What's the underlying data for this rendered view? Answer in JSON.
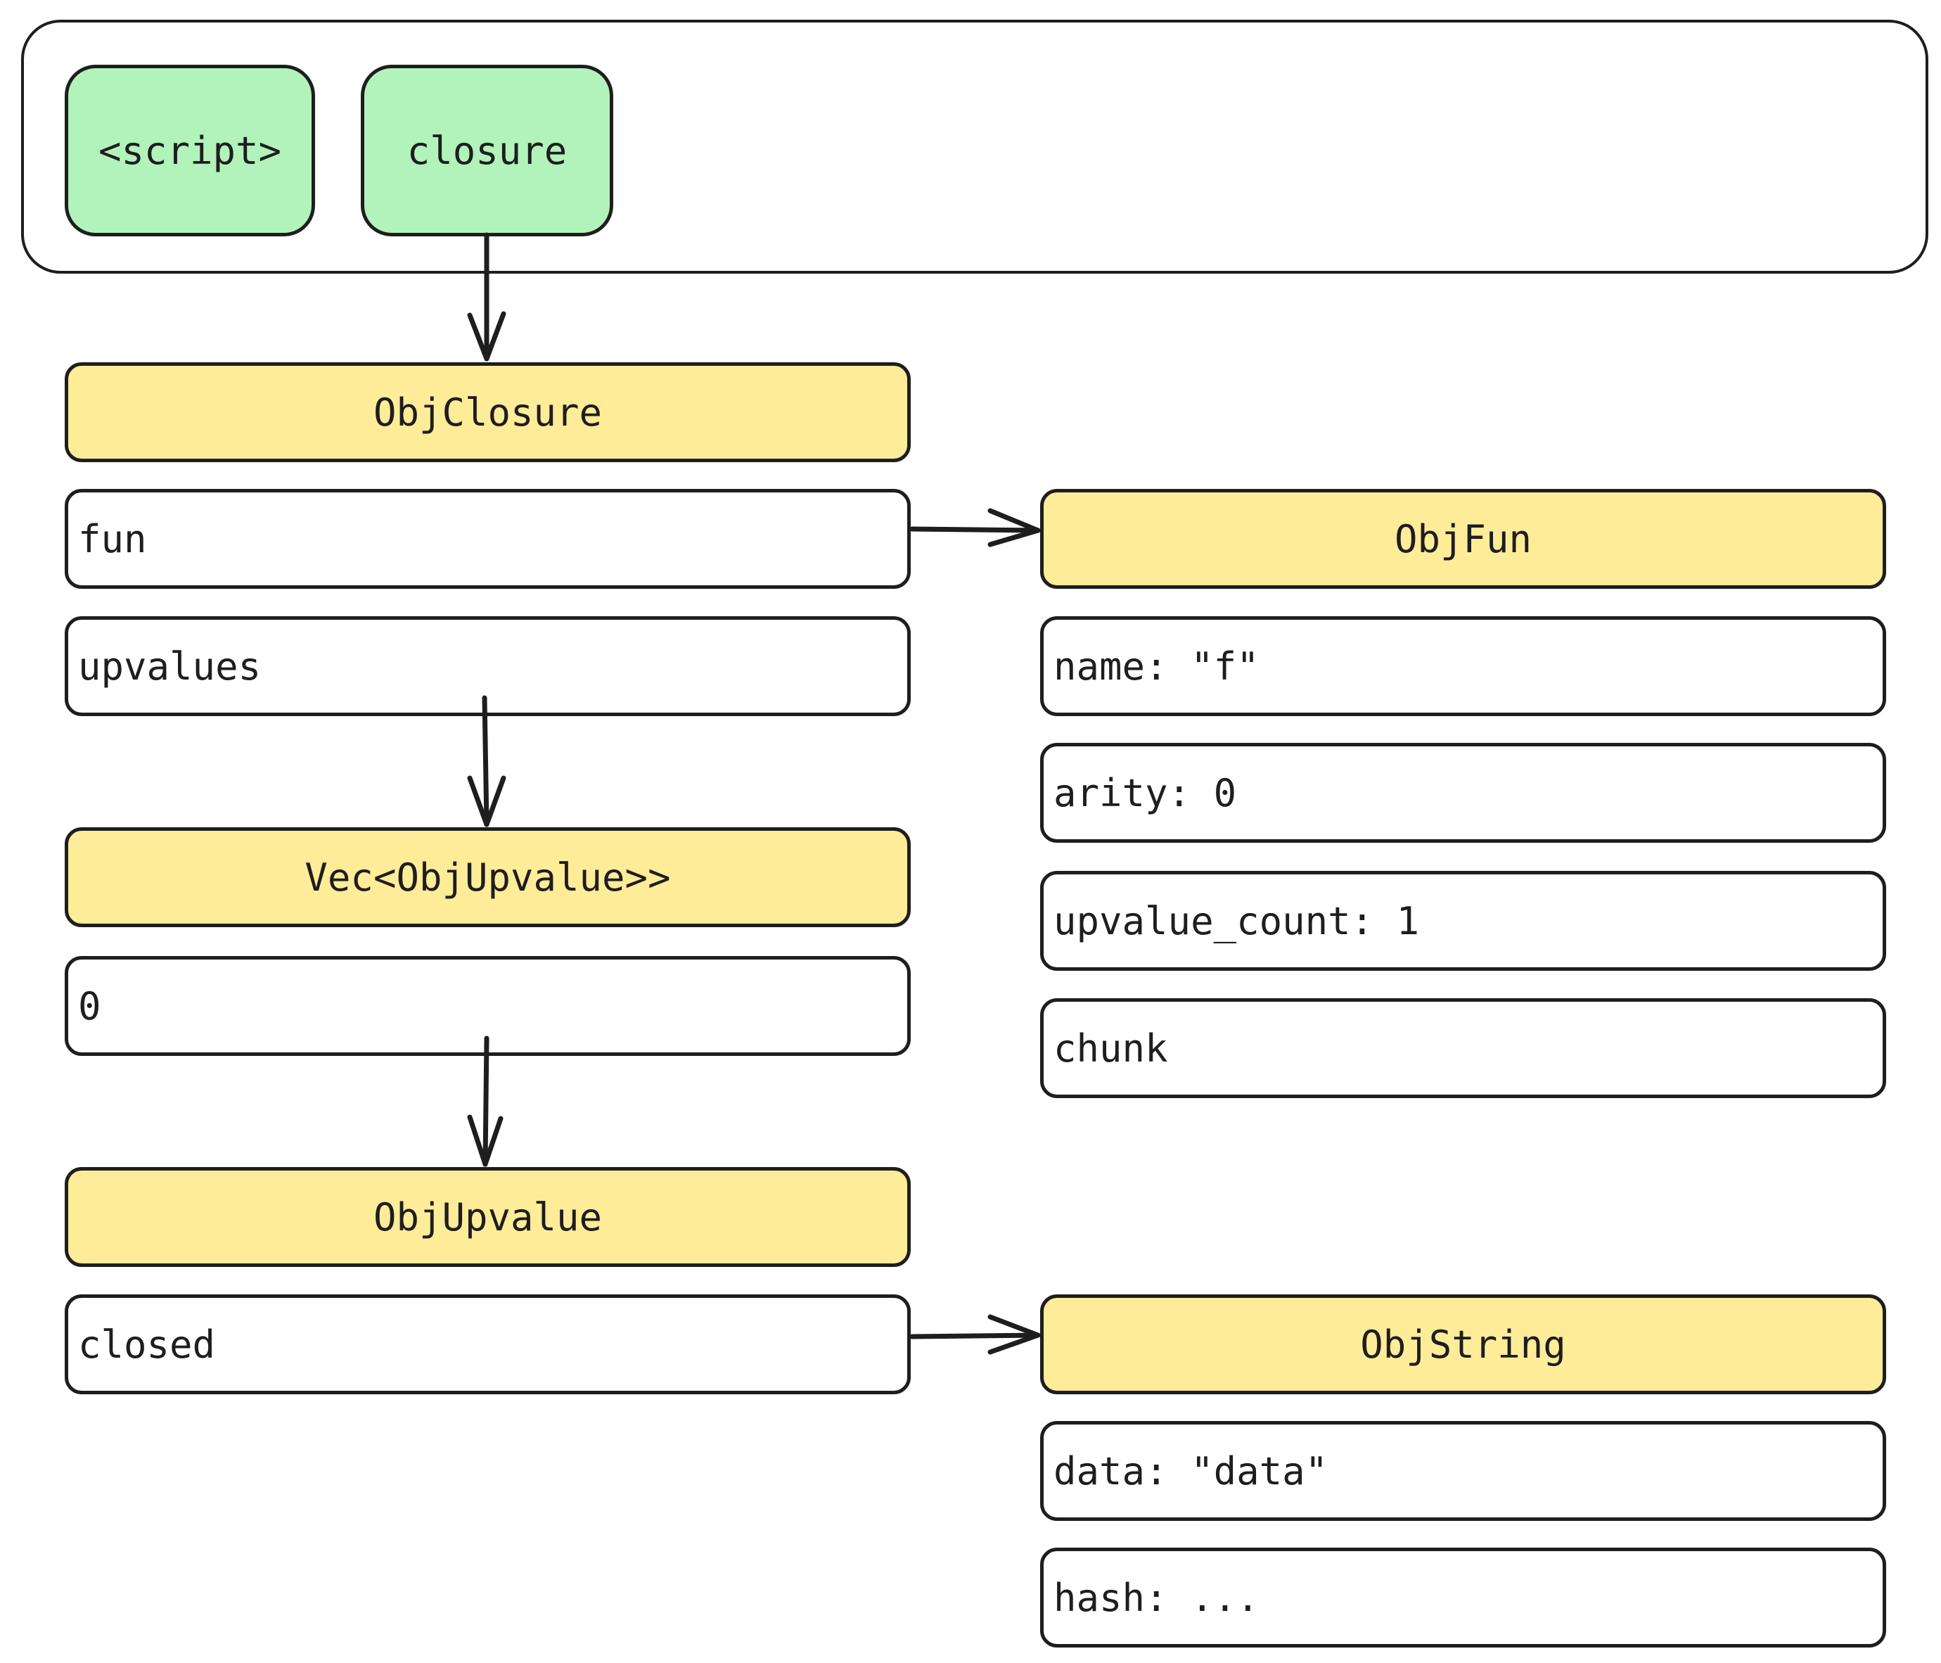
{
  "stack": {
    "slots": [
      {
        "label": "<script>"
      },
      {
        "label": "closure"
      }
    ]
  },
  "obj_closure": {
    "title": "ObjClosure",
    "fields": [
      "fun",
      "upvalues"
    ]
  },
  "vec_upvalue": {
    "title": "Vec<ObjUpvalue>>",
    "fields": [
      "0"
    ]
  },
  "obj_upvalue": {
    "title": "ObjUpvalue",
    "fields": [
      "closed"
    ]
  },
  "obj_fun": {
    "title": "ObjFun",
    "fields": [
      "name: \"f\"",
      "arity: 0",
      "upvalue_count: 1",
      "chunk"
    ]
  },
  "obj_string": {
    "title": "ObjString",
    "fields": [
      "data: \"data\"",
      "hash: ..."
    ]
  },
  "colors": {
    "stack_slot": "#b2f2bb",
    "object_header": "#ffec99",
    "stroke": "#1e1e1e"
  },
  "edges": [
    {
      "from": "stack.closure",
      "to": "ObjClosure"
    },
    {
      "from": "ObjClosure.fun",
      "to": "ObjFun"
    },
    {
      "from": "ObjClosure.upvalues",
      "to": "Vec<ObjUpvalue>>"
    },
    {
      "from": "Vec<ObjUpvalue>>.0",
      "to": "ObjUpvalue"
    },
    {
      "from": "ObjUpvalue.closed",
      "to": "ObjString"
    }
  ]
}
